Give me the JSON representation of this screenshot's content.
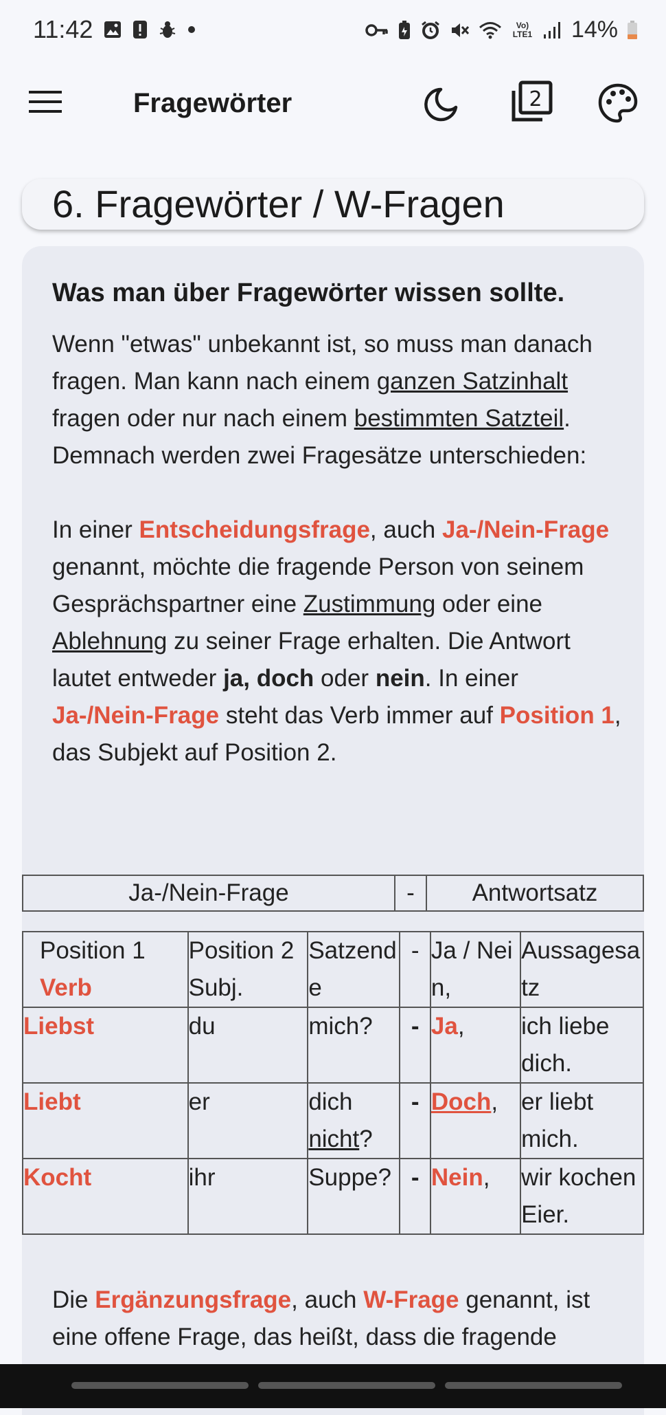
{
  "status_bar": {
    "time": "11:42",
    "battery_pct": "14%",
    "left_icons": [
      "image-icon",
      "alert-icon",
      "bug-icon",
      "dot-icon"
    ],
    "right_icons": [
      "key-icon",
      "battery-saver-icon",
      "alarm-icon",
      "mute-icon",
      "wifi-icon",
      "volte-icon",
      "signal-icon",
      "battery-icon"
    ],
    "volte_label": "Vo) LTE1"
  },
  "appbar": {
    "title": "Fragewörter",
    "pages_count": "2"
  },
  "section_title": "6. Fragewörter / W-Fragen",
  "content": {
    "heading": "Was man über Fragewörter wissen sollte.",
    "p1": {
      "t1": "Wenn \"etwas\" unbekannt ist, so muss man danach fragen. Man kann nach einem ",
      "u1": "ganzen Satzinhalt",
      "t2": " fragen oder nur nach einem ",
      "u2": "bestimmten Satzteil",
      "t3": ". Demnach werden zwei Fragesätze unterschieden:"
    },
    "p2": {
      "t1": "In einer ",
      "r1": "Entscheidungsfrage",
      "t2": ", auch ",
      "r2": "Ja-/Nein-Frage",
      "t3": " genannt, möchte die fragende Person von seinem Gesprächspartner eine ",
      "u1": "Zustimmung",
      "t4": " oder eine ",
      "u2": "Ablehnung",
      "t5": " zu seiner Frage erhalten. Die Antwort lautet entweder ",
      "b1": "ja, doch",
      "t6": " oder ",
      "b2": "nein",
      "t7": ". In einer ",
      "r3": "Ja-/Nein-Frage",
      "t8": " steht das Verb immer auf ",
      "r4": "Position 1",
      "t9": ", das Subjekt auf Position 2."
    }
  },
  "table_header": {
    "left": "Ja-/Nein-Frage",
    "mid": "-",
    "right": "Antwortsatz"
  },
  "table": {
    "head": {
      "pos1": "Position 1",
      "verb": "Verb",
      "pos2": "Position 2 Subj.",
      "satzende": "Satzende",
      "dash": "-",
      "janein": "Ja / Nein,",
      "aussage": "Aussagesatz"
    },
    "rows": [
      {
        "verb": "Liebst",
        "subj": "du",
        "end_a": "mich?",
        "end_b": "",
        "dash": "-",
        "answer": "Ja",
        "answer_underline": false,
        "comma": ",",
        "statement": "ich liebe dich."
      },
      {
        "verb": "Liebt",
        "subj": "er",
        "end_a": "dich ",
        "end_b": "nicht",
        "end_c": "?",
        "dash": "-",
        "answer": "Doch",
        "answer_underline": true,
        "comma": ",",
        "statement": "er liebt mich."
      },
      {
        "verb": "Kocht",
        "subj": "ihr",
        "end_a": "Suppe?",
        "end_b": "",
        "dash": "-",
        "answer": "Nein",
        "answer_underline": false,
        "comma": ",",
        "statement": "wir kochen Eier."
      }
    ]
  },
  "bottom_paragraph": {
    "t1": "Die ",
    "r1": "Ergänzungsfrage",
    "t2": ", auch ",
    "r2": "W-Frage",
    "t3": " genannt, ist eine offene Frage, das heißt, dass die fragende"
  },
  "colors": {
    "accent_red": "#e0533f",
    "background": "#f6f7fb",
    "card": "#e9ebf2"
  }
}
